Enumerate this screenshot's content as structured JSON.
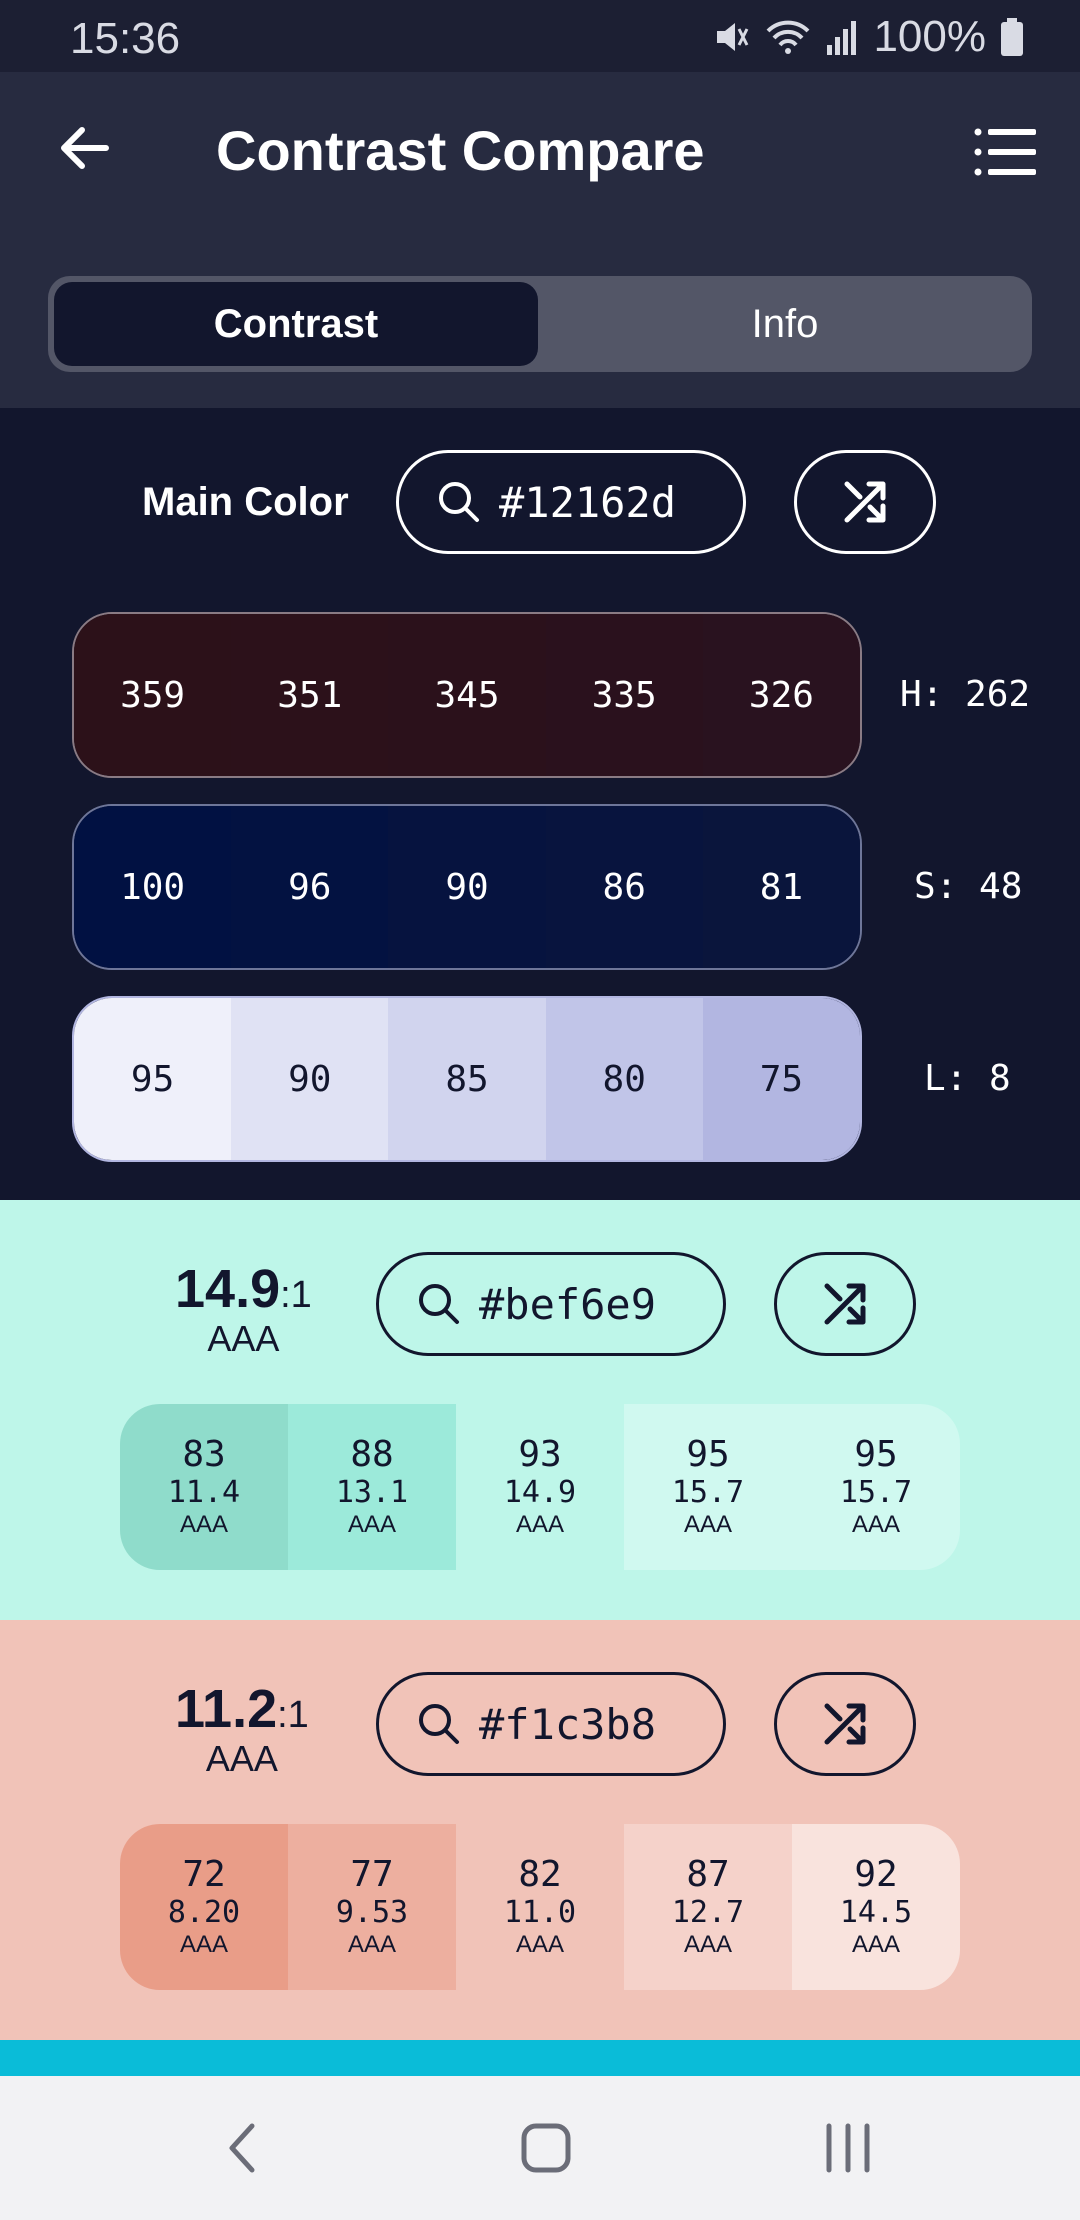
{
  "status_bar": {
    "time": "15:36",
    "battery": "100%"
  },
  "header": {
    "title": "Contrast Compare"
  },
  "tabs": [
    {
      "label": "Contrast",
      "active": true
    },
    {
      "label": "Info",
      "active": false
    }
  ],
  "main_color": {
    "label": "Main Color",
    "hex": "#12162d",
    "hue": {
      "label": "H: 262",
      "steps": [
        "359",
        "351",
        "345",
        "335",
        "326"
      ],
      "colors": [
        "#2c1119",
        "#2c111a",
        "#2b111b",
        "#2a111d",
        "#29121f"
      ]
    },
    "saturation": {
      "label": "S: 48",
      "steps": [
        "100",
        "96",
        "90",
        "86",
        "81"
      ],
      "colors": [
        "#011142",
        "#031241",
        "#06133f",
        "#08143e",
        "#0a153c"
      ]
    },
    "lightness": {
      "label": "L: 8",
      "steps": [
        "95",
        "90",
        "85",
        "80",
        "75"
      ],
      "colors": [
        "#eff0fa",
        "#e0e2f4",
        "#d1d4ee",
        "#c1c5e8",
        "#b2b6e1"
      ]
    }
  },
  "compare_colors": [
    {
      "ratio": "14.9",
      "ratio_suffix": ":1",
      "rating": "AAA",
      "hex": "#bef6e9",
      "background": "#bef6e9",
      "swatches": [
        {
          "value": "83",
          "contrast": "11.4",
          "rating": "AAA",
          "color": "#8fdccb"
        },
        {
          "value": "88",
          "contrast": "13.1",
          "rating": "AAA",
          "color": "#9ceada"
        },
        {
          "value": "93",
          "contrast": "14.9",
          "rating": "AAA",
          "color": "#bef6e9"
        },
        {
          "value": "95",
          "contrast": "15.7",
          "rating": "AAA",
          "color": "#d0f9f0"
        },
        {
          "value": "95",
          "contrast": "15.7",
          "rating": "AAA",
          "color": "#d0f9f0"
        }
      ]
    },
    {
      "ratio": "11.2",
      "ratio_suffix": ":1",
      "rating": "AAA",
      "hex": "#f1c3b8",
      "background": "#f1c3b8",
      "swatches": [
        {
          "value": "72",
          "contrast": "8.20",
          "rating": "AAA",
          "color": "#e99d88"
        },
        {
          "value": "77",
          "contrast": "9.53",
          "rating": "AAA",
          "color": "#edaf9f"
        },
        {
          "value": "82",
          "contrast": "11.0",
          "rating": "AAA",
          "color": "#f1c3b8"
        },
        {
          "value": "87",
          "contrast": "12.7",
          "rating": "AAA",
          "color": "#f5d2ca"
        },
        {
          "value": "92",
          "contrast": "14.5",
          "rating": "AAA",
          "color": "#f9e3dd"
        }
      ]
    }
  ],
  "accent": {
    "strip": "#0abcd8"
  }
}
